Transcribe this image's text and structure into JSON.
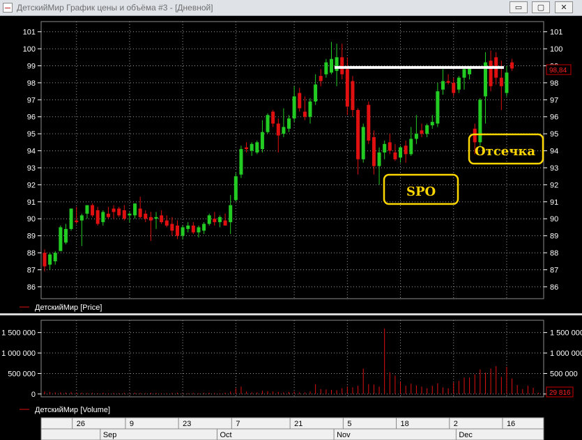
{
  "window": {
    "title": "ДетскийМир График цены и объёма #3 - [Дневной]",
    "minimize_glyph": "▭",
    "maximize_glyph": "▢",
    "close_glyph": "✕",
    "icon": "chart-window-icon"
  },
  "colors": {
    "up": "#22cc22",
    "down": "#e01010",
    "grid": "#9a9a9a",
    "annotation": "#ffd700",
    "volume": "#e01010",
    "resistance": "#ffffff"
  },
  "chart_data": [
    {
      "type": "candlestick",
      "legend": "ДетскийМир [Price]",
      "y_ticks": [
        86,
        87,
        88,
        89,
        90,
        91,
        92,
        93,
        94,
        95,
        96,
        97,
        98,
        99,
        100,
        101
      ],
      "ylim": [
        85.3,
        101.6
      ],
      "x_tick_labels": [
        "26",
        "9",
        "23",
        "7",
        "21",
        "5",
        "18",
        "2",
        "16"
      ],
      "months": [
        "Sep",
        "Oct",
        "Nov",
        "Dec"
      ],
      "last_price": "98,84",
      "resistance_level": 98.9,
      "annotations": [
        "SPO",
        "Отсечка"
      ],
      "candles": [
        {
          "o": 88.0,
          "h": 88.2,
          "l": 86.9,
          "c": 87.2
        },
        {
          "o": 87.3,
          "h": 88.0,
          "l": 87.0,
          "c": 87.9
        },
        {
          "o": 87.5,
          "h": 88.1,
          "l": 87.3,
          "c": 88.0
        },
        {
          "o": 88.1,
          "h": 89.6,
          "l": 88.1,
          "c": 89.5
        },
        {
          "o": 88.6,
          "h": 89.7,
          "l": 88.5,
          "c": 89.4
        },
        {
          "o": 89.4,
          "h": 90.6,
          "l": 89.3,
          "c": 90.6
        },
        {
          "o": 89.9,
          "h": 90.7,
          "l": 89.7,
          "c": 89.8
        },
        {
          "o": 89.9,
          "h": 90.3,
          "l": 88.4,
          "c": 90.2
        },
        {
          "o": 90.3,
          "h": 90.8,
          "l": 90.0,
          "c": 90.8
        },
        {
          "o": 90.8,
          "h": 90.9,
          "l": 90.1,
          "c": 90.2
        },
        {
          "o": 90.5,
          "h": 90.7,
          "l": 89.6,
          "c": 89.7
        },
        {
          "o": 89.8,
          "h": 90.5,
          "l": 89.6,
          "c": 90.4
        },
        {
          "o": 90.3,
          "h": 90.7,
          "l": 90.0,
          "c": 90.1
        },
        {
          "o": 90.6,
          "h": 90.8,
          "l": 90.0,
          "c": 90.4
        },
        {
          "o": 90.6,
          "h": 90.7,
          "l": 90.1,
          "c": 90.2
        },
        {
          "o": 90.5,
          "h": 90.8,
          "l": 89.9,
          "c": 90.0
        },
        {
          "o": 90.2,
          "h": 90.4,
          "l": 89.8,
          "c": 90.3
        },
        {
          "o": 90.2,
          "h": 90.9,
          "l": 90.0,
          "c": 90.9
        },
        {
          "o": 90.6,
          "h": 91.3,
          "l": 90.0,
          "c": 90.1
        },
        {
          "o": 90.3,
          "h": 90.5,
          "l": 89.8,
          "c": 90.0
        },
        {
          "o": 90.1,
          "h": 90.4,
          "l": 88.7,
          "c": 89.9
        },
        {
          "o": 90.0,
          "h": 90.4,
          "l": 89.4,
          "c": 90.1
        },
        {
          "o": 90.2,
          "h": 90.5,
          "l": 89.7,
          "c": 89.8
        },
        {
          "o": 89.9,
          "h": 90.2,
          "l": 89.5,
          "c": 89.6
        },
        {
          "o": 89.7,
          "h": 90.1,
          "l": 89.0,
          "c": 89.3
        },
        {
          "o": 89.6,
          "h": 89.9,
          "l": 88.8,
          "c": 89.0
        },
        {
          "o": 89.0,
          "h": 89.6,
          "l": 88.8,
          "c": 89.5
        },
        {
          "o": 89.4,
          "h": 89.8,
          "l": 89.2,
          "c": 89.6
        },
        {
          "o": 89.6,
          "h": 89.8,
          "l": 89.1,
          "c": 89.2
        },
        {
          "o": 89.2,
          "h": 89.6,
          "l": 88.9,
          "c": 89.5
        },
        {
          "o": 89.3,
          "h": 89.8,
          "l": 89.1,
          "c": 89.7
        },
        {
          "o": 89.7,
          "h": 90.3,
          "l": 89.6,
          "c": 90.2
        },
        {
          "o": 90.0,
          "h": 90.4,
          "l": 89.6,
          "c": 89.8
        },
        {
          "o": 89.8,
          "h": 90.2,
          "l": 89.5,
          "c": 90.1
        },
        {
          "o": 89.9,
          "h": 90.3,
          "l": 89.6,
          "c": 89.6
        },
        {
          "o": 89.8,
          "h": 91.4,
          "l": 89.1,
          "c": 90.8
        },
        {
          "o": 91.1,
          "h": 92.7,
          "l": 91.0,
          "c": 92.5
        },
        {
          "o": 92.6,
          "h": 94.3,
          "l": 92.4,
          "c": 94.1
        },
        {
          "o": 94.2,
          "h": 94.5,
          "l": 93.9,
          "c": 94.1
        },
        {
          "o": 94.0,
          "h": 94.5,
          "l": 93.7,
          "c": 94.4
        },
        {
          "o": 93.9,
          "h": 94.6,
          "l": 93.8,
          "c": 94.5
        },
        {
          "o": 94.1,
          "h": 95.8,
          "l": 93.9,
          "c": 95.1
        },
        {
          "o": 95.1,
          "h": 96.2,
          "l": 95.0,
          "c": 96.1
        },
        {
          "o": 96.3,
          "h": 96.4,
          "l": 95.4,
          "c": 95.6
        },
        {
          "o": 95.6,
          "h": 95.9,
          "l": 93.9,
          "c": 94.9
        },
        {
          "o": 95.0,
          "h": 96.5,
          "l": 94.8,
          "c": 95.4
        },
        {
          "o": 95.3,
          "h": 96.1,
          "l": 95.1,
          "c": 95.9
        },
        {
          "o": 95.9,
          "h": 97.8,
          "l": 95.7,
          "c": 97.2
        },
        {
          "o": 97.4,
          "h": 97.7,
          "l": 96.3,
          "c": 96.5
        },
        {
          "o": 96.3,
          "h": 97.2,
          "l": 95.8,
          "c": 96.0
        },
        {
          "o": 96.0,
          "h": 97.1,
          "l": 95.6,
          "c": 96.9
        },
        {
          "o": 96.9,
          "h": 98.5,
          "l": 96.7,
          "c": 97.9
        },
        {
          "o": 98.4,
          "h": 98.8,
          "l": 97.8,
          "c": 98.1
        },
        {
          "o": 98.5,
          "h": 99.4,
          "l": 98.3,
          "c": 99.2
        },
        {
          "o": 98.6,
          "h": 100.4,
          "l": 98.5,
          "c": 99.4
        },
        {
          "o": 98.7,
          "h": 100.3,
          "l": 97.8,
          "c": 99.5
        },
        {
          "o": 99.5,
          "h": 100.3,
          "l": 98.2,
          "c": 98.5
        },
        {
          "o": 98.8,
          "h": 99.5,
          "l": 96.1,
          "c": 96.6
        },
        {
          "o": 98.1,
          "h": 98.4,
          "l": 96.0,
          "c": 96.4
        },
        {
          "o": 96.4,
          "h": 96.5,
          "l": 92.6,
          "c": 93.5
        },
        {
          "o": 93.5,
          "h": 95.6,
          "l": 93.3,
          "c": 95.4
        },
        {
          "o": 96.7,
          "h": 96.9,
          "l": 94.4,
          "c": 94.6
        },
        {
          "o": 94.8,
          "h": 95.2,
          "l": 92.6,
          "c": 93.1
        },
        {
          "o": 93.1,
          "h": 94.2,
          "l": 92.0,
          "c": 93.9
        },
        {
          "o": 93.9,
          "h": 94.6,
          "l": 93.5,
          "c": 94.4
        },
        {
          "o": 94.5,
          "h": 95.0,
          "l": 93.8,
          "c": 94.0
        },
        {
          "o": 93.9,
          "h": 94.4,
          "l": 93.4,
          "c": 93.5
        },
        {
          "o": 93.6,
          "h": 94.3,
          "l": 93.3,
          "c": 94.2
        },
        {
          "o": 94.3,
          "h": 94.6,
          "l": 93.3,
          "c": 93.8
        },
        {
          "o": 93.8,
          "h": 95.4,
          "l": 93.7,
          "c": 94.7
        },
        {
          "o": 94.7,
          "h": 96.1,
          "l": 94.4,
          "c": 95.0
        },
        {
          "o": 95.2,
          "h": 95.6,
          "l": 94.8,
          "c": 95.0
        },
        {
          "o": 95.0,
          "h": 95.6,
          "l": 94.8,
          "c": 95.5
        },
        {
          "o": 95.5,
          "h": 96.1,
          "l": 95.3,
          "c": 95.7
        },
        {
          "o": 95.6,
          "h": 98.0,
          "l": 95.4,
          "c": 97.5
        },
        {
          "o": 97.6,
          "h": 98.8,
          "l": 97.3,
          "c": 98.1
        },
        {
          "o": 98.1,
          "h": 98.5,
          "l": 97.9,
          "c": 98.0
        },
        {
          "o": 98.0,
          "h": 98.3,
          "l": 97.2,
          "c": 97.4
        },
        {
          "o": 97.6,
          "h": 98.4,
          "l": 97.4,
          "c": 98.3
        },
        {
          "o": 98.3,
          "h": 98.9,
          "l": 97.6,
          "c": 98.8
        },
        {
          "o": 98.5,
          "h": 98.9,
          "l": 98.2,
          "c": 98.9
        },
        {
          "o": 95.3,
          "h": 95.6,
          "l": 93.8,
          "c": 94.5
        },
        {
          "o": 94.5,
          "h": 97.1,
          "l": 94.2,
          "c": 97.0
        },
        {
          "o": 97.2,
          "h": 99.8,
          "l": 95.6,
          "c": 99.2
        },
        {
          "o": 99.3,
          "h": 99.9,
          "l": 97.5,
          "c": 97.8
        },
        {
          "o": 99.5,
          "h": 99.8,
          "l": 97.9,
          "c": 98.3
        },
        {
          "o": 98.3,
          "h": 99.3,
          "l": 96.4,
          "c": 97.8
        },
        {
          "o": 97.4,
          "h": 99.0,
          "l": 97.2,
          "c": 98.6
        },
        {
          "o": 99.2,
          "h": 99.4,
          "l": 98.7,
          "c": 98.84
        }
      ]
    },
    {
      "type": "bar",
      "legend": "ДетскийМир [Volume]",
      "y_ticks": [
        0,
        500000,
        1000000,
        1500000
      ],
      "y_tick_labels": [
        "0",
        "500 000",
        "1 000 000",
        "1 500 000"
      ],
      "ylim": [
        -70000,
        1800000
      ],
      "last_volume": "29 816",
      "values": [
        60000,
        50000,
        40000,
        40000,
        35000,
        45000,
        30000,
        30000,
        25000,
        25000,
        20000,
        30000,
        20000,
        25000,
        20000,
        25000,
        20000,
        30000,
        25000,
        20000,
        30000,
        25000,
        20000,
        20000,
        25000,
        30000,
        20000,
        20000,
        25000,
        20000,
        25000,
        30000,
        25000,
        20000,
        30000,
        60000,
        140000,
        180000,
        60000,
        40000,
        40000,
        80000,
        70000,
        60000,
        50000,
        40000,
        50000,
        60000,
        40000,
        40000,
        60000,
        240000,
        120000,
        110000,
        100000,
        90000,
        140000,
        180000,
        160000,
        200000,
        620000,
        240000,
        230000,
        180000,
        1600000,
        530000,
        450000,
        300000,
        200000,
        250000,
        210000,
        180000,
        140000,
        200000,
        260000,
        160000,
        140000,
        280000,
        320000,
        400000,
        400000,
        480000,
        600000,
        520000,
        620000,
        680000,
        420000,
        660000,
        380000,
        220000,
        120000,
        200000,
        150000,
        29816
      ]
    }
  ]
}
